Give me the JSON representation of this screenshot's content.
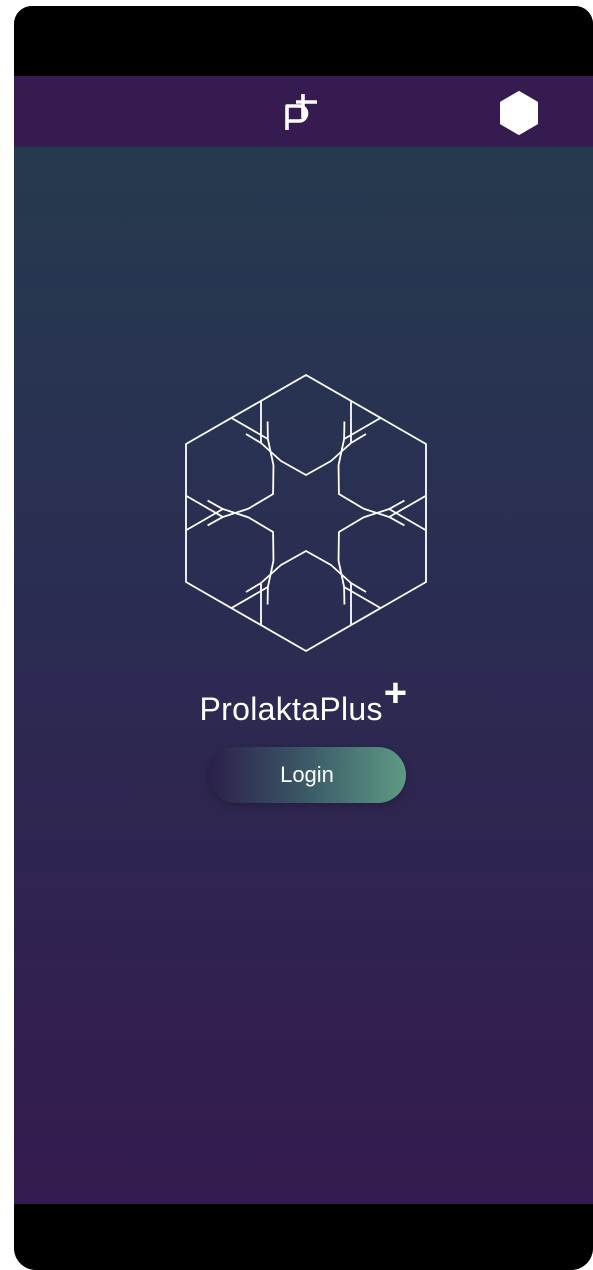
{
  "brand": {
    "name": "ProlaktaPlus",
    "superscript": "+"
  },
  "login": {
    "label": "Login"
  },
  "icons": {
    "nav_logo": "prolakta-p-plus-icon",
    "nav_menu": "hexagon-icon",
    "emblem": "hexagonal-star-emblem-icon"
  },
  "colors": {
    "navbar": "#351b4f",
    "background_top": "#263a4e",
    "background_bottom": "#341b4f",
    "button_start": "#2c1f4b",
    "button_end": "#5e9a85",
    "text": "#ffffff"
  }
}
